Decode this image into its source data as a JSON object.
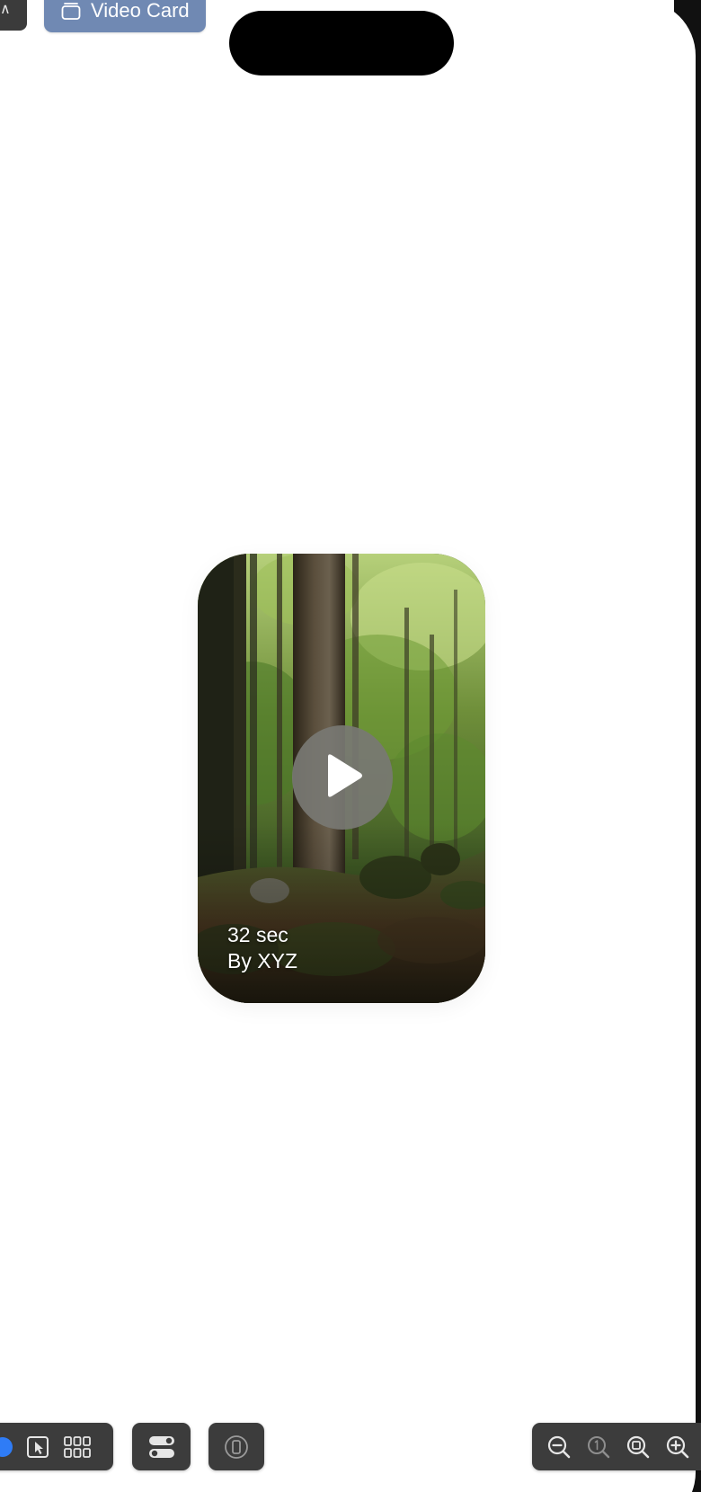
{
  "preview_chip": {
    "label": "Video Card",
    "icon": "window-stack-icon"
  },
  "left_chip": {
    "glyph": "∧"
  },
  "video_card": {
    "duration": "32 sec",
    "author": "By XYZ",
    "thumbnail": "forest-scene",
    "play_icon": "play-icon"
  },
  "toolbar": {
    "mode_group": [
      "live-icon",
      "select-cursor-icon",
      "grid-variants-icon"
    ],
    "settings_icon": "canvas-settings-icon",
    "device_icon": "device-settings-icon",
    "zoom_group": [
      "zoom-out-icon",
      "zoom-actual-size-icon",
      "zoom-to-fit-icon",
      "zoom-in-icon"
    ]
  },
  "colors": {
    "chip_background": "#7089b3",
    "toolbar_background": "#3c3c3c",
    "live_accent": "#2f7cf6",
    "play_button": "#787873"
  }
}
